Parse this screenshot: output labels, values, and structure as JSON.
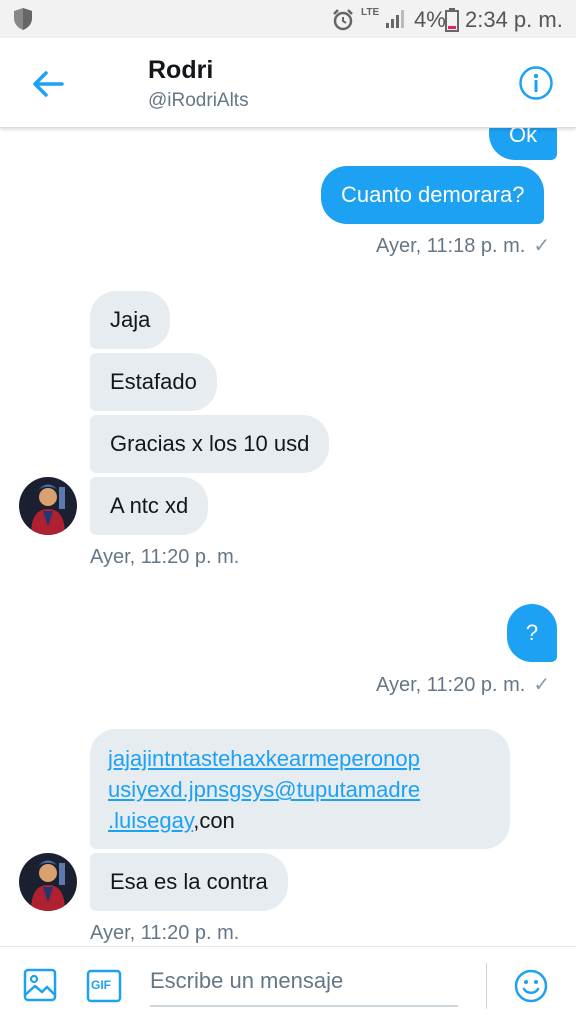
{
  "status_bar": {
    "network": "LTE",
    "battery_pct": "4%",
    "time": "2:34 p. m."
  },
  "header": {
    "name": "Rodri",
    "handle": "@iRodriAlts"
  },
  "messages": {
    "out_ok": "Ok",
    "out_cuanto": "Cuanto demorara?",
    "ts_1": "Ayer, 11:18 p. m.",
    "in_jaja": "Jaja",
    "in_estafado": "Estafado",
    "in_gracias": "Gracias x los 10 usd",
    "in_antc": "A ntc xd",
    "ts_2": "Ayer, 11:20 p. m.",
    "out_q": "?",
    "ts_3": "Ayer, 11:20 p. m.",
    "in_link_line1": "jajajintntastehaxkearmeperonop",
    "in_link_line2": "usiyexd.jpnsgsys@tuputamadre",
    "in_link_line3": ".luisegay",
    "in_link_tail": ",con",
    "in_contra": "Esa es la contra",
    "ts_4": "Ayer, 11:20 p. m."
  },
  "compose": {
    "placeholder": "Escribe un mensaje",
    "gif_label": "GIF"
  },
  "colors": {
    "accent": "#1da1f2",
    "incoming_bubble": "#e6ecf0",
    "secondary_text": "#657786"
  },
  "icons": [
    "shield-icon",
    "alarm-icon",
    "signal-icon",
    "battery-icon",
    "back-arrow-icon",
    "info-icon",
    "image-icon",
    "gif-icon",
    "emoji-icon"
  ]
}
